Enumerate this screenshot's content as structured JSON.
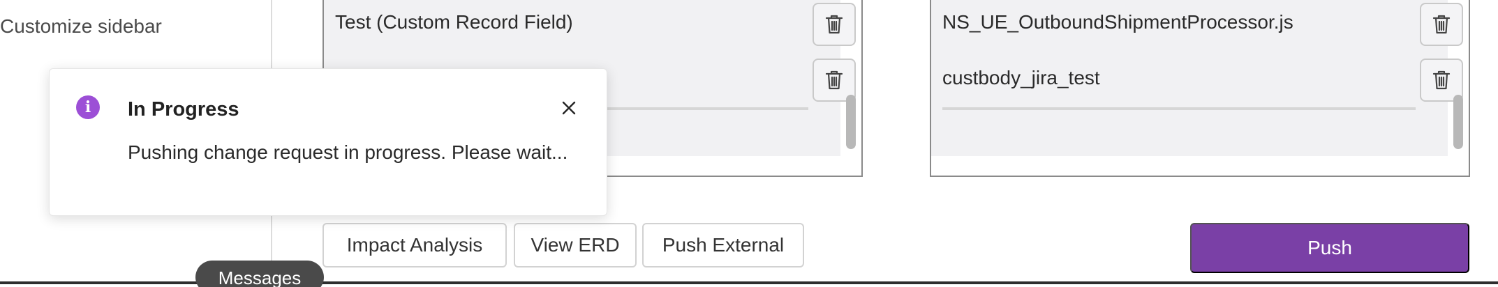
{
  "sidebar": {
    "customize_label": "Customize sidebar"
  },
  "left_panel": {
    "rows": [
      {
        "label": "Test (Custom Record Field)"
      },
      {
        "label": ""
      }
    ]
  },
  "right_panel": {
    "rows": [
      {
        "label": "NS_UE_OutboundShipmentProcessor.js"
      },
      {
        "label": "custbody_jira_test"
      }
    ]
  },
  "actions": {
    "impact_analysis": "Impact Analysis",
    "view_erd": "View ERD",
    "push_external": "Push External",
    "push": "Push"
  },
  "toast": {
    "title": "In Progress",
    "message": "Pushing change request in progress. Please wait...",
    "icon": "info-icon"
  },
  "footer": {
    "messages_label": "Messages"
  },
  "colors": {
    "primary": "#7a40a6",
    "info": "#9c4fd6"
  }
}
